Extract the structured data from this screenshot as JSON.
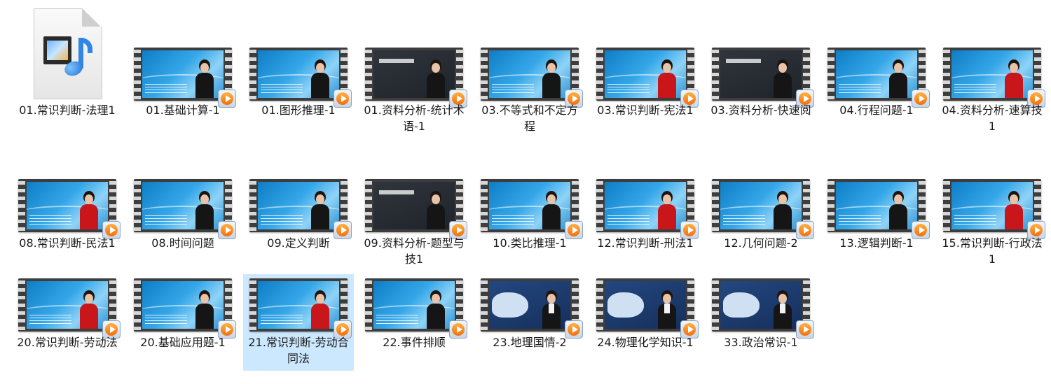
{
  "files": [
    {
      "label": "01.常识判断-法理1",
      "kind": "audio-document",
      "icon": "media-file-icon"
    },
    {
      "label": "01.基础计算-1",
      "kind": "video",
      "style": "blue",
      "presenter": "female"
    },
    {
      "label": "01.图形推理-1",
      "kind": "video",
      "style": "blue",
      "presenter": "female"
    },
    {
      "label": "01.资料分析-统计术语-1",
      "kind": "video",
      "style": "dark",
      "presenter": "female"
    },
    {
      "label": "03.不等式和不定方程",
      "kind": "video",
      "style": "blue",
      "presenter": "female"
    },
    {
      "label": "03.常识判断-宪法1",
      "kind": "video",
      "style": "blue",
      "presenter": "female-red"
    },
    {
      "label": "03.资料分析-快速阅",
      "kind": "video",
      "style": "dark",
      "presenter": "female"
    },
    {
      "label": "04.行程问题-1",
      "kind": "video",
      "style": "blue",
      "presenter": "female"
    },
    {
      "label": "04.资料分析-速算技1",
      "kind": "video",
      "style": "blue",
      "presenter": "female-red"
    },
    {
      "label": "08.常识判断-民法1",
      "kind": "video",
      "style": "blue",
      "presenter": "female-red"
    },
    {
      "label": "08.时间问题",
      "kind": "video",
      "style": "blue",
      "presenter": "female"
    },
    {
      "label": "09.定义判断",
      "kind": "video",
      "style": "blue",
      "presenter": "female"
    },
    {
      "label": "09.资料分析-题型与技1",
      "kind": "video",
      "style": "dark",
      "presenter": "female"
    },
    {
      "label": "10.类比推理-1",
      "kind": "video",
      "style": "blue",
      "presenter": "female"
    },
    {
      "label": "12.常识判断-刑法1",
      "kind": "video",
      "style": "blue",
      "presenter": "female-red"
    },
    {
      "label": "12.几何问题-2",
      "kind": "video",
      "style": "blue",
      "presenter": "female"
    },
    {
      "label": "13.逻辑判断-1",
      "kind": "video",
      "style": "blue",
      "presenter": "female"
    },
    {
      "label": "15.常识判断-行政法1",
      "kind": "video",
      "style": "blue",
      "presenter": "female-red"
    },
    {
      "label": "20.常识判断-劳动法",
      "kind": "video",
      "style": "blue",
      "presenter": "female-red"
    },
    {
      "label": "20.基础应用题-1",
      "kind": "video",
      "style": "blue",
      "presenter": "female"
    },
    {
      "label": "21.常识判断-劳动合同法",
      "kind": "video",
      "style": "blue",
      "presenter": "female-red",
      "selected": true
    },
    {
      "label": "22.事件排顺",
      "kind": "video",
      "style": "blue",
      "presenter": "female"
    },
    {
      "label": "23.地理国情-2",
      "kind": "video",
      "style": "map",
      "presenter": "male"
    },
    {
      "label": "24.物理化学知识-1",
      "kind": "video",
      "style": "map",
      "presenter": "male"
    },
    {
      "label": "33.政治常识-1",
      "kind": "video",
      "style": "map",
      "presenter": "male"
    }
  ],
  "colors": {
    "selection": "#cce8ff",
    "play": "#f36f0c"
  }
}
